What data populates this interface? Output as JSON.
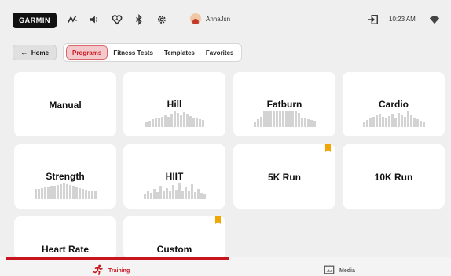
{
  "topbar": {
    "logo": "GARMIN",
    "icons": [
      "activity-icon",
      "volume-icon",
      "heart-icon",
      "bluetooth-icon",
      "gear-icon",
      "logout-icon",
      "wifi-icon"
    ],
    "username": "AnnaJsn",
    "time": "10:23 AM"
  },
  "nav": {
    "home_label": "Home",
    "tabs": [
      {
        "label": "Programs",
        "active": true
      },
      {
        "label": "Fitness Tests",
        "active": false
      },
      {
        "label": "Templates",
        "active": false
      },
      {
        "label": "Favorites",
        "active": false
      }
    ]
  },
  "programs": [
    {
      "name": "Manual",
      "profile": [],
      "bookmarked": false
    },
    {
      "name": "Hill",
      "profile": [
        0.25,
        0.35,
        0.45,
        0.5,
        0.55,
        0.6,
        0.7,
        0.6,
        0.75,
        0.95,
        0.8,
        0.7,
        0.85,
        0.75,
        0.65,
        0.55,
        0.5,
        0.45,
        0.4
      ],
      "bookmarked": false
    },
    {
      "name": "Fatburn",
      "profile": [
        0.3,
        0.45,
        0.6,
        0.9,
        0.95,
        0.95,
        0.95,
        0.95,
        0.95,
        0.95,
        0.95,
        0.95,
        0.95,
        0.95,
        0.8,
        0.55,
        0.5,
        0.45,
        0.4,
        0.35
      ],
      "bookmarked": false
    },
    {
      "name": "Cardio",
      "profile": [
        0.25,
        0.4,
        0.55,
        0.6,
        0.7,
        0.75,
        0.6,
        0.5,
        0.65,
        0.75,
        0.55,
        0.8,
        0.7,
        0.6,
        0.95,
        0.7,
        0.5,
        0.45,
        0.35,
        0.3
      ],
      "bookmarked": false
    },
    {
      "name": "Strength",
      "profile": [
        0.6,
        0.6,
        0.65,
        0.7,
        0.7,
        0.75,
        0.75,
        0.8,
        0.85,
        0.9,
        0.85,
        0.8,
        0.75,
        0.7,
        0.65,
        0.6,
        0.55,
        0.5,
        0.45,
        0.45
      ],
      "bookmarked": false
    },
    {
      "name": "HIIT",
      "profile": [
        0.25,
        0.45,
        0.35,
        0.6,
        0.4,
        0.75,
        0.45,
        0.65,
        0.5,
        0.8,
        0.55,
        0.95,
        0.5,
        0.7,
        0.45,
        0.85,
        0.4,
        0.6,
        0.35,
        0.3
      ],
      "bookmarked": false
    },
    {
      "name": "5K Run",
      "profile": [],
      "bookmarked": true
    },
    {
      "name": "10K Run",
      "profile": [],
      "bookmarked": false
    },
    {
      "name": "Heart Rate",
      "profile": [],
      "bookmarked": false
    },
    {
      "name": "Custom",
      "profile": [],
      "bookmarked": true
    }
  ],
  "bottom_nav": [
    {
      "label": "Training",
      "icon": "runner-icon",
      "active": true
    },
    {
      "label": "Media",
      "icon": "media-icon",
      "active": false
    }
  ],
  "colors": {
    "accent": "#c8151d",
    "active_tab_bg": "#f4c9cb",
    "bookmark": "#f0a500",
    "bars": "#d3d3d3"
  }
}
